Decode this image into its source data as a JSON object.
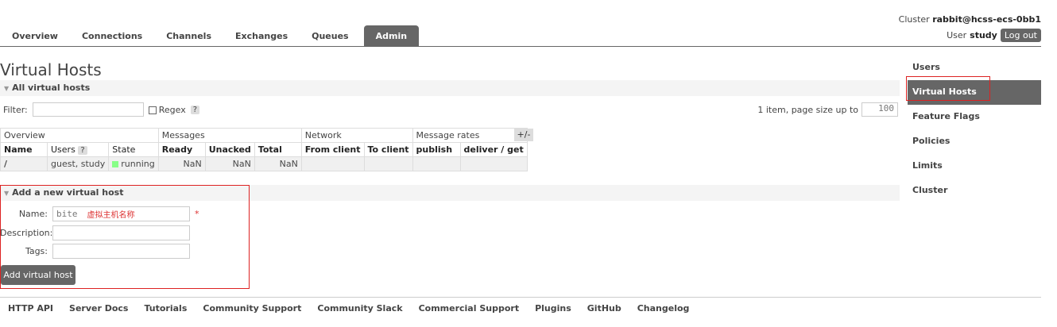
{
  "header": {
    "cluster_label": "Cluster",
    "cluster_name": "rabbit@hcss-ecs-0bb1",
    "user_label": "User",
    "user_name": "study",
    "logout_label": "Log out"
  },
  "tabs": [
    {
      "label": "Overview",
      "active": false
    },
    {
      "label": "Connections",
      "active": false
    },
    {
      "label": "Channels",
      "active": false
    },
    {
      "label": "Exchanges",
      "active": false
    },
    {
      "label": "Queues",
      "active": false
    },
    {
      "label": "Admin",
      "active": true
    }
  ],
  "page": {
    "title": "Virtual Hosts",
    "all_section": "All virtual hosts",
    "filter_label": "Filter:",
    "filter_value": "",
    "regex_label": "Regex",
    "help_glyph": "?",
    "pager_text": "1 item, page size up to",
    "page_size": "100"
  },
  "table": {
    "groups": [
      "Overview",
      "Messages",
      "Network",
      "Message rates"
    ],
    "plusminus": "+/-",
    "columns": [
      "Name",
      "Users",
      "State",
      "Ready",
      "Unacked",
      "Total",
      "From client",
      "To client",
      "publish",
      "deliver / get"
    ],
    "rows": [
      {
        "name": "/",
        "users": "guest, study",
        "state": "running",
        "ready": "NaN",
        "unacked": "NaN",
        "total": "NaN",
        "from_client": "",
        "to_client": "",
        "publish": "",
        "deliver_get": ""
      }
    ]
  },
  "add_form": {
    "section": "Add a new virtual host",
    "name_label": "Name:",
    "name_value": "bite",
    "name_hint": "虚拟主机名称",
    "required_mark": "*",
    "description_label": "Description:",
    "description_value": "",
    "tags_label": "Tags:",
    "tags_value": "",
    "submit_label": "Add virtual host"
  },
  "sidebar": {
    "items": [
      {
        "label": "Users",
        "active": false
      },
      {
        "label": "Virtual Hosts",
        "active": true
      },
      {
        "label": "Feature Flags",
        "active": false
      },
      {
        "label": "Policies",
        "active": false
      },
      {
        "label": "Limits",
        "active": false
      },
      {
        "label": "Cluster",
        "active": false
      }
    ]
  },
  "footer": {
    "links": [
      "HTTP API",
      "Server Docs",
      "Tutorials",
      "Community Support",
      "Community Slack",
      "Commercial Support",
      "Plugins",
      "GitHub",
      "Changelog"
    ]
  },
  "colors": {
    "accent_gray": "#666666",
    "running_green": "#88ff88",
    "highlight_red": "#dd2222"
  }
}
